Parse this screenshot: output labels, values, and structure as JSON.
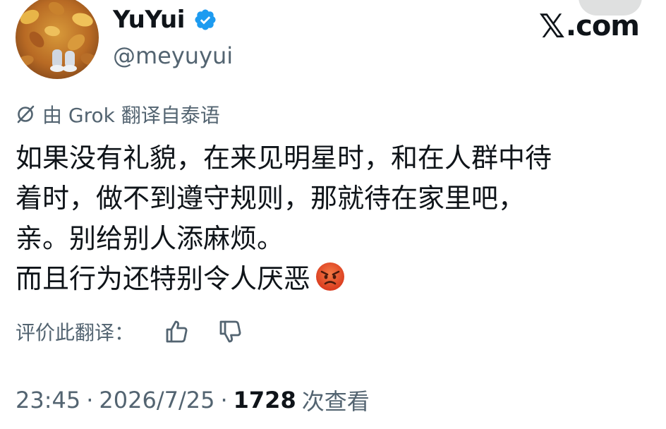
{
  "author": {
    "display_name": "YuYui",
    "handle": "@meyuyui",
    "verified": true
  },
  "brand": {
    "logo_x": "𝕏",
    "logo_suffix": ".com"
  },
  "translation": {
    "icon": "grok-icon",
    "label": "由 Grok 翻译自泰语"
  },
  "tweet": {
    "lines": [
      "如果没有礼貌，在来见明星时，和在人群中待",
      "着时，做不到遵守规则，那就待在家里吧，",
      "亲。别给别人添麻烦。",
      "而且行为还特别令人厌恶"
    ],
    "emoji": "angry-face-emoji"
  },
  "rating": {
    "label": "评价此翻译：",
    "thumbs_up_icon": "thumbs-up-icon",
    "thumbs_down_icon": "thumbs-down-icon"
  },
  "meta": {
    "time": "23:45",
    "separator": "·",
    "date": "2026/7/25",
    "views_count": "1728",
    "views_label": "次查看"
  },
  "colors": {
    "text_primary": "#0f1419",
    "text_secondary": "#536471",
    "verified_blue": "#1d9bf0",
    "emoji_red": "#e8532c"
  }
}
